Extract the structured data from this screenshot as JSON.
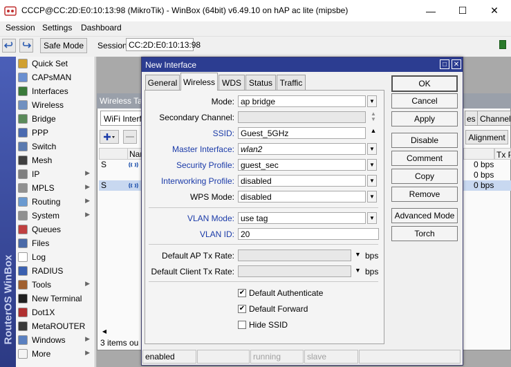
{
  "window": {
    "title": "CCCP@CC:2D:E0:10:13:98 (MikroTik) - WinBox (64bit) v6.49.10 on hAP ac lite (mipsbe)",
    "minimize": "—",
    "maximize": "☐",
    "close": "✕"
  },
  "menu": [
    "Session",
    "Settings",
    "Dashboard"
  ],
  "toolbar": {
    "safe_mode": "Safe Mode",
    "session_label": "Session:",
    "session_value": "CC:2D:E0:10:13:98"
  },
  "sidebar": {
    "brand": "RouterOS WinBox",
    "items": [
      {
        "label": "Quick Set",
        "icon": "wand-icon",
        "color": "#d0a030",
        "arrow": false
      },
      {
        "label": "CAPsMAN",
        "icon": "capsman-icon",
        "color": "#6a8fd0",
        "arrow": false
      },
      {
        "label": "Interfaces",
        "icon": "interfaces-icon",
        "color": "#3a7a3a",
        "arrow": false
      },
      {
        "label": "Wireless",
        "icon": "wireless-icon",
        "color": "#7090c0",
        "arrow": false
      },
      {
        "label": "Bridge",
        "icon": "bridge-icon",
        "color": "#5a8a5a",
        "arrow": false
      },
      {
        "label": "PPP",
        "icon": "ppp-icon",
        "color": "#4a6ab0",
        "arrow": false
      },
      {
        "label": "Switch",
        "icon": "switch-icon",
        "color": "#5a7ab0",
        "arrow": false
      },
      {
        "label": "Mesh",
        "icon": "mesh-icon",
        "color": "#404040",
        "arrow": false
      },
      {
        "label": "IP",
        "icon": "ip-icon",
        "color": "#808080",
        "arrow": true
      },
      {
        "label": "MPLS",
        "icon": "mpls-icon",
        "color": "#909090",
        "arrow": true
      },
      {
        "label": "Routing",
        "icon": "routing-icon",
        "color": "#6a9ad0",
        "arrow": true
      },
      {
        "label": "System",
        "icon": "gear-icon",
        "color": "#909090",
        "arrow": true
      },
      {
        "label": "Queues",
        "icon": "queues-icon",
        "color": "#c04040",
        "arrow": false
      },
      {
        "label": "Files",
        "icon": "folder-icon",
        "color": "#4a6aa8",
        "arrow": false
      },
      {
        "label": "Log",
        "icon": "log-icon",
        "color": "#ffffff",
        "arrow": false
      },
      {
        "label": "RADIUS",
        "icon": "radius-icon",
        "color": "#3a60b0",
        "arrow": false
      },
      {
        "label": "Tools",
        "icon": "tools-icon",
        "color": "#a06030",
        "arrow": true
      },
      {
        "label": "New Terminal",
        "icon": "terminal-icon",
        "color": "#202020",
        "arrow": false
      },
      {
        "label": "Dot1X",
        "icon": "dot1x-icon",
        "color": "#b03030",
        "arrow": false
      },
      {
        "label": "MetaROUTER",
        "icon": "metarouter-icon",
        "color": "#3a3a3a",
        "arrow": false
      },
      {
        "label": "Windows",
        "icon": "windows-icon",
        "color": "#5a80c0",
        "arrow": true
      },
      {
        "label": "More",
        "icon": "more-icon",
        "color": "#f4f4f4",
        "arrow": true
      }
    ]
  },
  "bgwindow": {
    "title": "Wireless Tab",
    "tab_first": "WiFi Interfa",
    "tab_right1": "es",
    "tab_right2": "Channels",
    "alignment": "Alignment",
    "col_name": "Nam",
    "col_tx": "Tx P",
    "rows": [
      {
        "flag": "S",
        "bps": "0 bps"
      },
      {
        "flag": "",
        "bps": "0 bps"
      },
      {
        "flag": "S",
        "bps": "0 bps"
      }
    ],
    "footer": "3 items ou"
  },
  "dialog": {
    "title": "New Interface",
    "tabs": [
      "General",
      "Wireless",
      "WDS",
      "Status",
      "Traffic"
    ],
    "active_tab": "Wireless",
    "fields": {
      "mode": {
        "label": "Mode:",
        "value": "ap bridge"
      },
      "secondary_channel": {
        "label": "Secondary Channel:",
        "value": ""
      },
      "ssid": {
        "label": "SSID:",
        "value": "Guest_5GHz"
      },
      "master_interface": {
        "label": "Master Interface:",
        "value": "wlan2"
      },
      "security_profile": {
        "label": "Security Profile:",
        "value": "guest_sec"
      },
      "interworking_profile": {
        "label": "Interworking Profile:",
        "value": "disabled"
      },
      "wps_mode": {
        "label": "WPS Mode:",
        "value": "disabled"
      },
      "vlan_mode": {
        "label": "VLAN Mode:",
        "value": "use tag"
      },
      "vlan_id": {
        "label": "VLAN ID:",
        "value": "20"
      },
      "default_ap_tx_rate": {
        "label": "Default AP Tx Rate:",
        "value": "",
        "unit": "bps"
      },
      "default_client_tx_rate": {
        "label": "Default Client Tx Rate:",
        "value": "",
        "unit": "bps"
      }
    },
    "checkboxes": [
      {
        "label": "Default Authenticate",
        "checked": true
      },
      {
        "label": "Default Forward",
        "checked": true
      },
      {
        "label": "Hide SSID",
        "checked": false
      }
    ],
    "buttons": [
      "OK",
      "Cancel",
      "Apply",
      "Disable",
      "Comment",
      "Copy",
      "Remove",
      "Advanced Mode",
      "Torch"
    ],
    "status": [
      "enabled",
      "",
      "running",
      "slave",
      ""
    ]
  },
  "colors": {
    "dialog_title_bg": "#2c3d91",
    "label_blue": "#1a3aa8",
    "sidebar_strip": "#3a4aa0",
    "status_led": "#2a7a2a"
  }
}
